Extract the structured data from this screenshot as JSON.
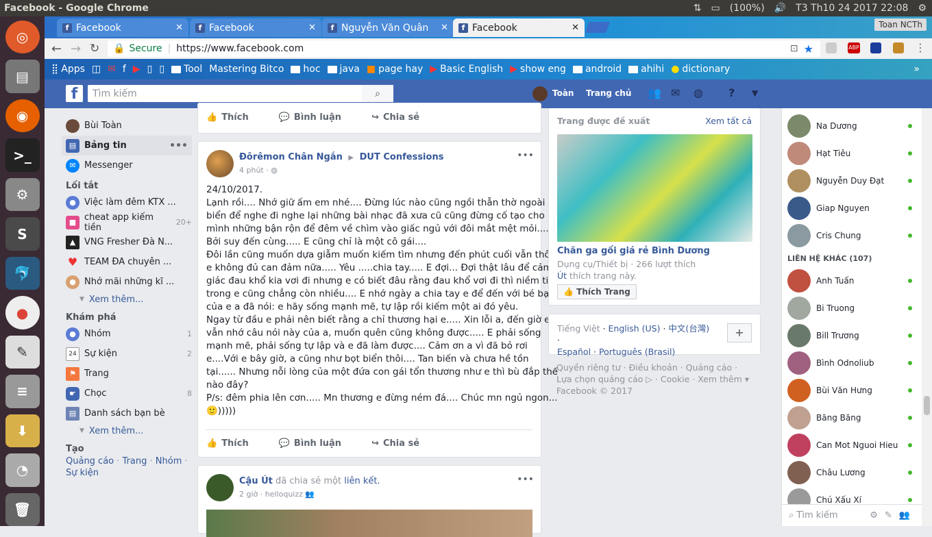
{
  "os": {
    "window_title": "Facebook - Google Chrome",
    "battery": "(100%)",
    "clock": "T3 Th10 24 2017 22:08"
  },
  "tabs": [
    {
      "label": "Facebook"
    },
    {
      "label": "Facebook"
    },
    {
      "label": "Nguyễn Văn Quân"
    },
    {
      "label": "Facebook"
    }
  ],
  "profile_name": "Toan NCTh",
  "address": {
    "secure": "Secure",
    "url": "https://www.facebook.com"
  },
  "bookmarks": [
    "Apps",
    "Tool",
    "Mastering Bitco",
    "hoc",
    "java",
    "page hay",
    "Basic English",
    "show eng",
    "android",
    "ahihi",
    "dictionary"
  ],
  "fbbar": {
    "search_placeholder": "Tìm kiếm",
    "user": "Toàn",
    "home": "Trang chủ"
  },
  "leftnav": {
    "user": "Bùi Toàn",
    "news": "Bảng tin",
    "messenger": "Messenger",
    "shortcuts_title": "Lối tắt",
    "shortcuts": [
      {
        "label": "Việc làm đêm KTX ...",
        "count": ""
      },
      {
        "label": "cheat app kiếm tiền",
        "count": "20+"
      },
      {
        "label": "VNG Fresher Đà N...",
        "count": ""
      },
      {
        "label": "TEAM ĐA chuyên ...",
        "count": ""
      },
      {
        "label": "Nhớ mãi những kĩ ...",
        "count": ""
      }
    ],
    "more1": "Xem thêm...",
    "explore_title": "Khám phá",
    "explore": [
      {
        "label": "Nhóm",
        "count": "1"
      },
      {
        "label": "Sự kiện",
        "count": "2"
      },
      {
        "label": "Trang",
        "count": ""
      },
      {
        "label": "Chọc",
        "count": "8"
      },
      {
        "label": "Danh sách bạn bè",
        "count": ""
      }
    ],
    "more2": "Xem thêm...",
    "create_title": "Tạo",
    "create_links": [
      "Quảng cáo",
      "Trang",
      "Nhóm",
      "Sự kiện"
    ]
  },
  "actions": {
    "like": "Thích",
    "comment": "Bình luận",
    "share": "Chia sẻ"
  },
  "post1": {
    "author": "Đôrêmon Chân Ngắn",
    "group": "DUT Confessions",
    "time": "4 phút",
    "lines": [
      "24/10/2017.",
      "Lạnh rồi.... Nhớ giữ ấm em nhé.... Đừng lúc nào cũng ngồi thẫn thờ ngoài",
      "biển để nghe đi nghe lại những bài nhạc đã xưa cũ cũng đừng cố tạo cho",
      "mình những bận rộn để đêm về chìm vào giấc ngủ với đôi mắt mệt mỏi.....",
      "Bởi suy đến cùng..... E cũng chỉ là một cô gái....",
      "Đôi lần cũng muốn dựa giẫm muốn kiếm tìm nhưng đến phút cuối vẫn thôi,",
      "e không đủ can đảm nữa..... Yêu .....chia tay..... E đợi... Đợi thật lâu để cảm",
      "giác đau khổ kia vơi đi nhưng e có biết đâu rằng đau khổ vơi đi thì niềm tin",
      "trong e cũng chẳng còn nhiều.... E nhớ ngày a chia tay e để đến với bé bạn",
      "của e a đã nói: e hãy sống mạnh mẽ, tự lập rồi kiếm một ai đó yêu.",
      "Ngay từ đầu e phải nên biết rằng a chỉ thương hại e..... Xin lỗi a, đến giờ e",
      "vẫn nhớ câu nói này của a, muốn quên cũng không được..... E phải sống",
      "mạnh mẽ, phải sống tự lập và e đã làm được.... Cảm ơn a vì đã bỏ rơi",
      "e....Với e bây giờ, a cũng như bọt biển thôi.... Tan biến và chưa hề tồn",
      "tại...... Nhưng nỗi lòng của một đứa con gái tổn thương như e thì bù đắp thế",
      "nào đây?",
      "P/s: đêm phia lên cơn..... Mn thương e đừng ném đá.... Chúc mn ngủ ngon...",
      "🙂)))))"
    ]
  },
  "post2": {
    "author": "Cậu Út",
    "mid": "đã chia sẻ một",
    "link": "liên kết.",
    "time": "2 giờ · helloquizz"
  },
  "suggest": {
    "title": "Trang được đề xuất",
    "see_all": "Xem tất cả",
    "page": "Chăn ga gối giá rẻ Bình Dương",
    "meta": "Dụng cụ/Thiết bị · 266 lượt thích",
    "liker": "Út",
    "liker_rest": "thích trang này.",
    "like_btn": "Thích Trang"
  },
  "langs": {
    "current": "Tiếng Việt",
    "others": [
      "English (US)",
      "中文(台灣)",
      "Español",
      "Português (Brasil)"
    ],
    "add": "+"
  },
  "footer": {
    "line1": "Quyền riêng tư · Điều khoản · Quảng cáo ·",
    "line2": "Lựa chọn quảng cáo ▷ · Cookie · Xem thêm ▾",
    "line3": "Facebook © 2017"
  },
  "chat": {
    "friends": [
      "Na Dương",
      "Hạt Tiêu",
      "Nguyễn Duy Đạt",
      "Giap Nguyen",
      "Cris Chung"
    ],
    "other_title": "LIÊN HỆ KHÁC (107)",
    "others": [
      "Anh Tuấn",
      "Bi Truong",
      "Bill Trương",
      "Bình Odnoliub",
      "Bùi Văn Hưng",
      "Băng Băng",
      "Can Mot Nguoi Hieu",
      "Châu Lương",
      "Chú Xấu Xí"
    ],
    "search_placeholder": "Tìm kiếm"
  },
  "colors": {
    "fb_blue": "#4267b2",
    "link": "#365899",
    "online": "#42b72a"
  }
}
